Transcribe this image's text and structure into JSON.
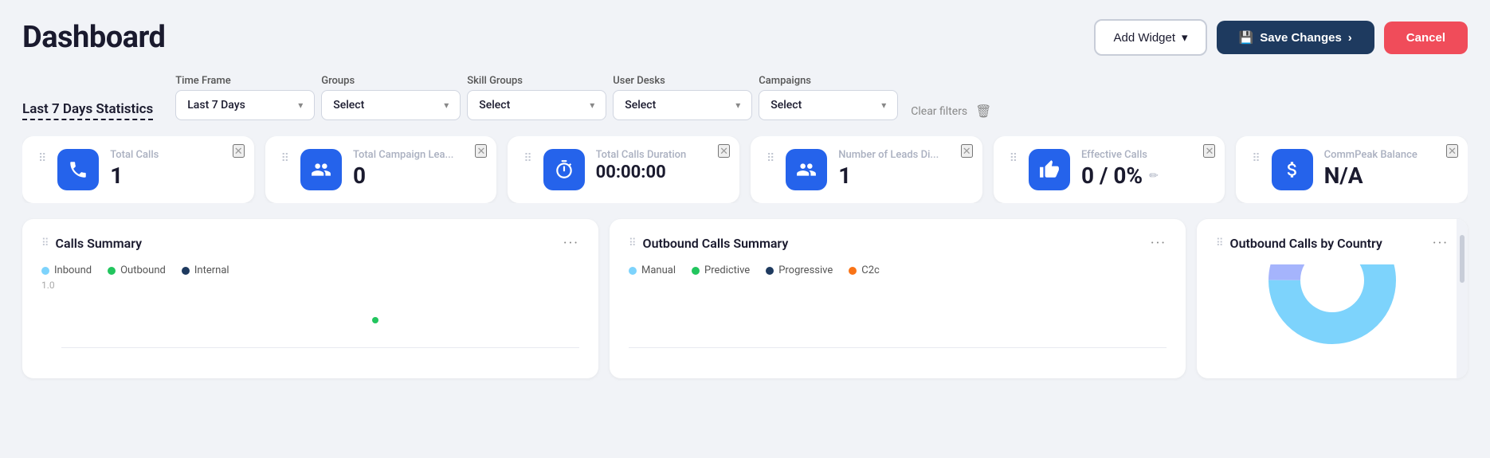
{
  "page": {
    "title": "Dashboard"
  },
  "header": {
    "add_widget_label": "Add Widget",
    "save_changes_label": "Save Changes",
    "cancel_label": "Cancel"
  },
  "filters": {
    "section_heading": "Last 7 Days Statistics",
    "time_frame": {
      "label": "Time Frame",
      "value": "Last 7 Days"
    },
    "groups": {
      "label": "Groups",
      "value": "Select"
    },
    "skill_groups": {
      "label": "Skill Groups",
      "value": "Select"
    },
    "user_desks": {
      "label": "User Desks",
      "value": "Select"
    },
    "campaigns": {
      "label": "Campaigns",
      "value": "Select"
    },
    "clear_filters_label": "Clear filters"
  },
  "stat_cards": [
    {
      "id": "total-calls",
      "label": "Total Calls",
      "value": "1",
      "icon": "phone"
    },
    {
      "id": "total-campaign-leads",
      "label": "Total Campaign Lea...",
      "value": "0",
      "icon": "users"
    },
    {
      "id": "total-calls-duration",
      "label": "Total Calls Duration",
      "value": "00:00:00",
      "icon": "timer"
    },
    {
      "id": "number-of-leads",
      "label": "Number of Leads Di...",
      "value": "1",
      "icon": "users"
    },
    {
      "id": "effective-calls",
      "label": "Effective Calls",
      "value": "0 / 0%",
      "icon": "thumbsup"
    },
    {
      "id": "commpeak-balance",
      "label": "CommPeak Balance",
      "value": "N/A",
      "icon": "coin"
    }
  ],
  "charts": [
    {
      "id": "calls-summary",
      "title": "Calls Summary",
      "legend": [
        {
          "label": "Inbound",
          "color": "#7dd3fc"
        },
        {
          "label": "Outbound",
          "color": "#22c55e"
        },
        {
          "label": "Internal",
          "color": "#1e3a5f"
        }
      ],
      "y_label": "1.0"
    },
    {
      "id": "outbound-calls-summary",
      "title": "Outbound Calls Summary",
      "legend": [
        {
          "label": "Manual",
          "color": "#7dd3fc"
        },
        {
          "label": "Predictive",
          "color": "#22c55e"
        },
        {
          "label": "Progressive",
          "color": "#1e3a5f"
        },
        {
          "label": "C2c",
          "color": "#f97316"
        }
      ]
    },
    {
      "id": "outbound-calls-by-country",
      "title": "Outbound Calls by Country",
      "legend": []
    }
  ]
}
